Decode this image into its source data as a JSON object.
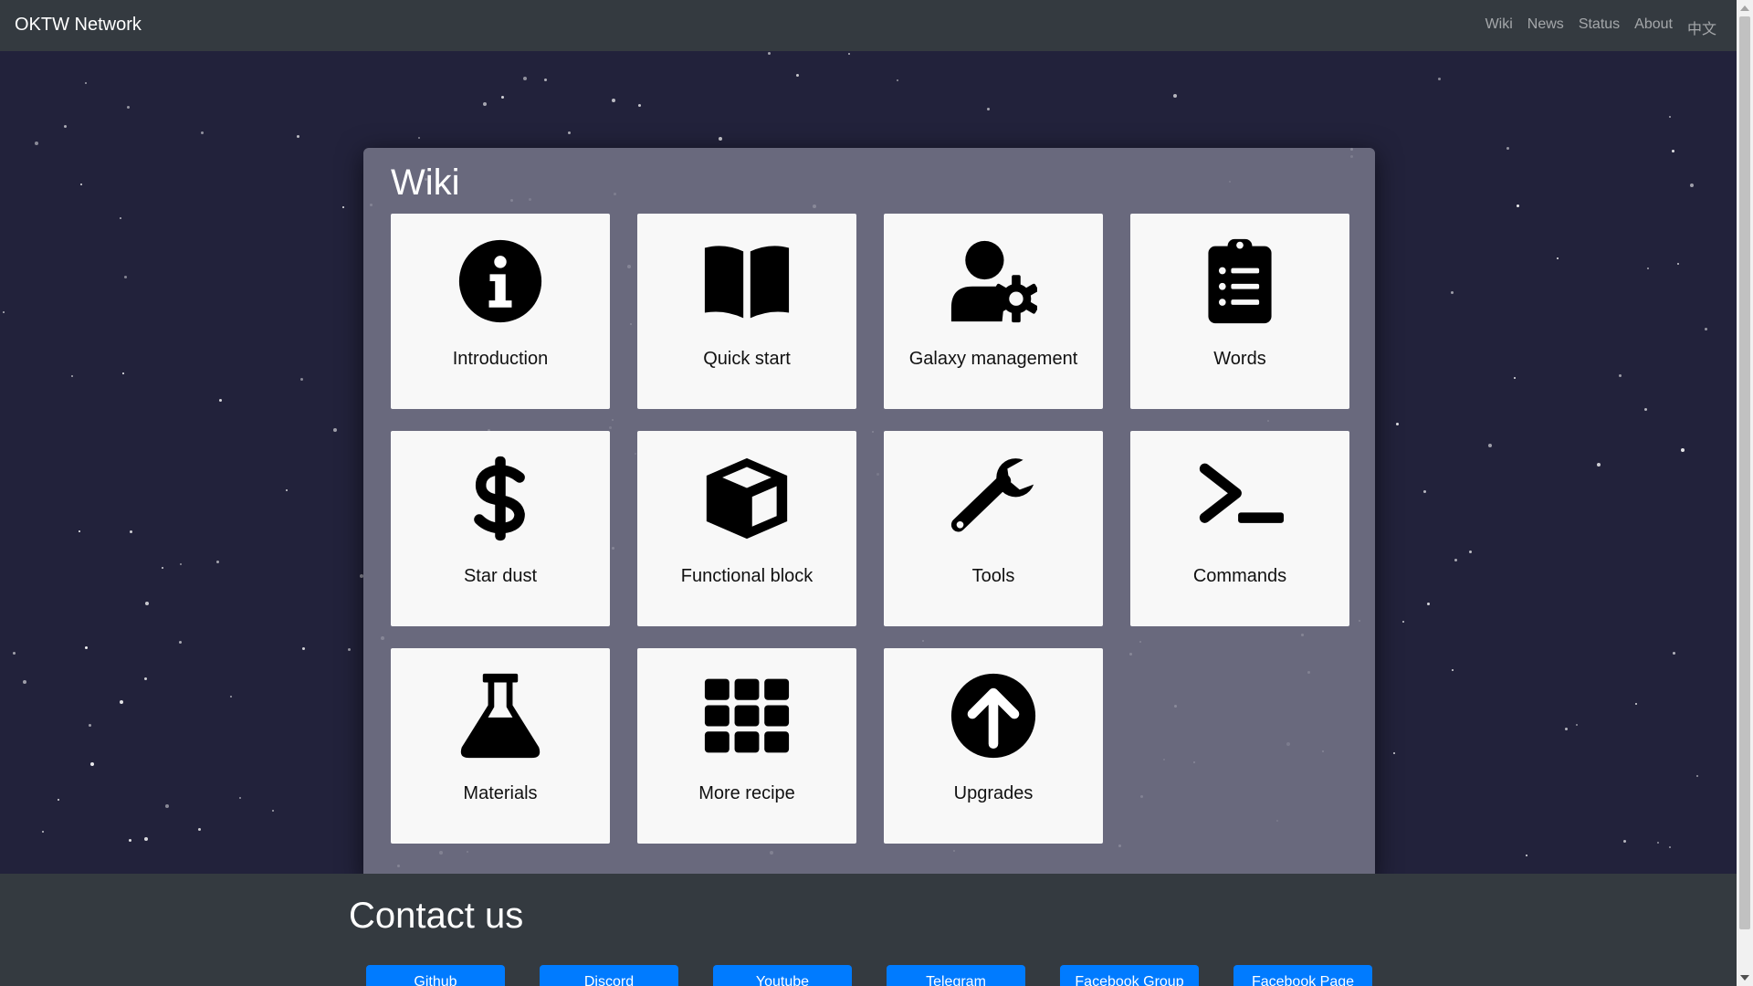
{
  "navbar": {
    "brand": "OKTW Network",
    "links": [
      "Wiki",
      "News",
      "Status",
      "About",
      "中文"
    ]
  },
  "wiki": {
    "title": "Wiki",
    "cards": [
      {
        "label": "Introduction",
        "icon": "info-circle-icon"
      },
      {
        "label": "Quick start",
        "icon": "book-open-icon"
      },
      {
        "label": "Galaxy management",
        "icon": "user-gear-icon"
      },
      {
        "label": "Words",
        "icon": "clipboard-list-icon"
      },
      {
        "label": "Star dust",
        "icon": "dollar-sign-icon"
      },
      {
        "label": "Functional block",
        "icon": "cube-icon"
      },
      {
        "label": "Tools",
        "icon": "wrench-icon"
      },
      {
        "label": "Commands",
        "icon": "terminal-icon"
      },
      {
        "label": "Materials",
        "icon": "flask-icon"
      },
      {
        "label": "More recipe",
        "icon": "grid-icon"
      },
      {
        "label": "Upgrades",
        "icon": "arrow-circle-up-icon"
      }
    ]
  },
  "contact": {
    "title": "Contact us",
    "buttons": [
      "Github",
      "Discord",
      "Youtube",
      "Telegram",
      "Facebook Group",
      "Facebook Page"
    ]
  },
  "colors": {
    "navbar_bg": "#343a40",
    "space_bg": "#22223b",
    "panel_bg": "#767688",
    "card_bg": "#f8f8f8",
    "button_bg": "#007bff"
  }
}
